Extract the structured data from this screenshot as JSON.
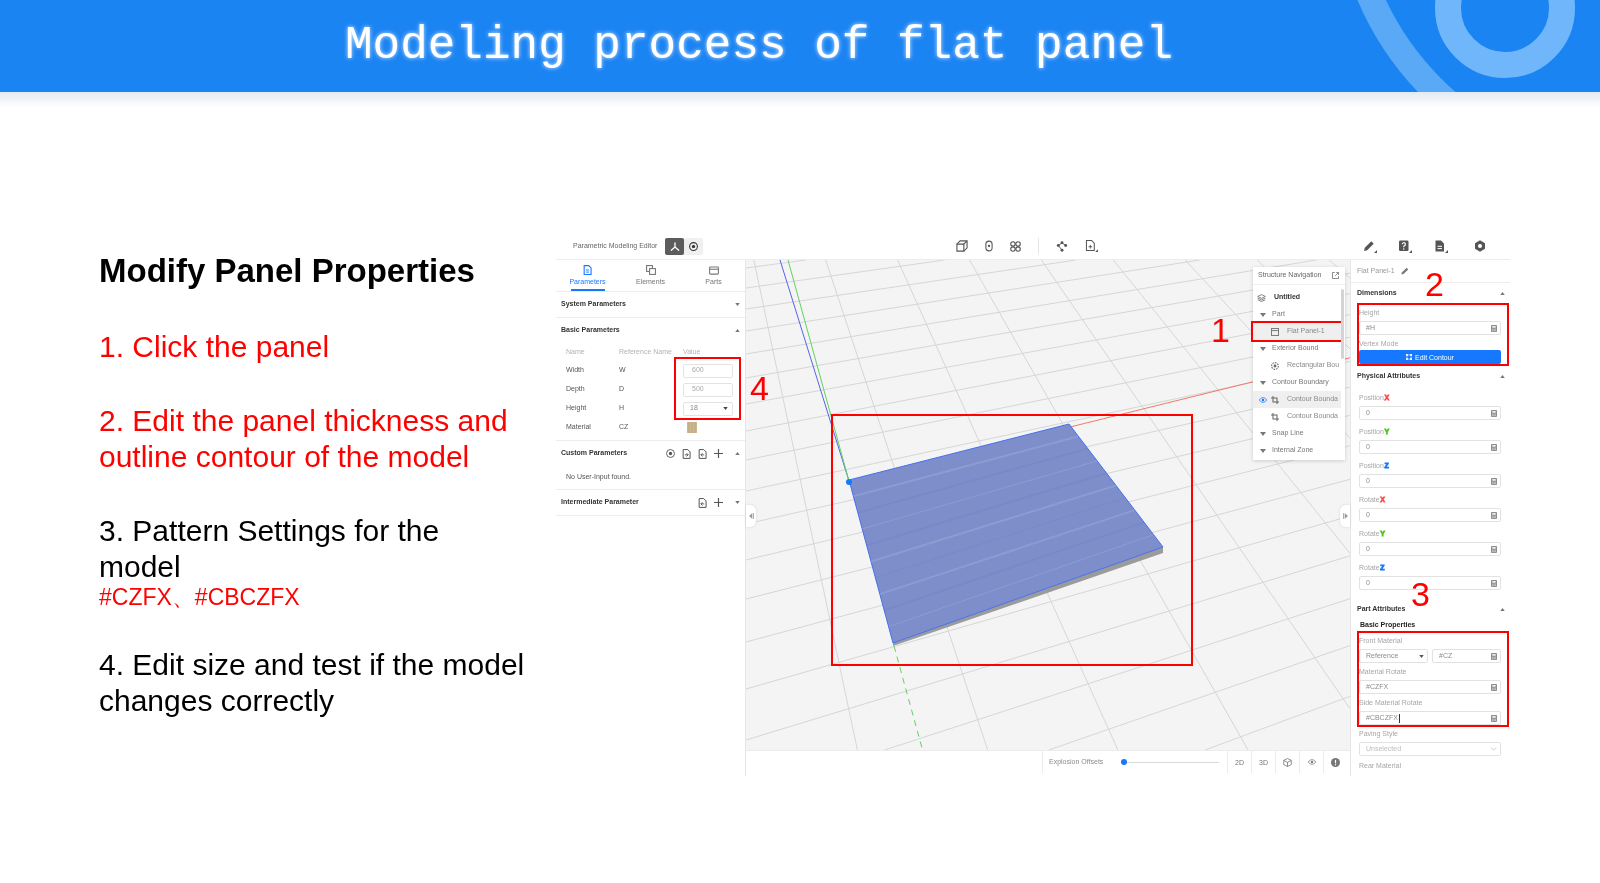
{
  "slide": {
    "title": "Modeling process of flat panel"
  },
  "instructions": {
    "heading": "Modify Panel Properties",
    "steps": [
      {
        "text": "1. Click the panel",
        "color": "#ff0000"
      },
      {
        "text": "2. Edit the panel thickness and outline contour of the model",
        "color": "#ff0000"
      },
      {
        "text": "3. Pattern Settings for the model",
        "color": "#000000",
        "note": "#CZFX、#CBCZFX"
      },
      {
        "text": "4. Edit size and test if the model changes correctly",
        "color": "#000000"
      }
    ]
  },
  "app": {
    "title": "Parametric Modeling Editor",
    "mode_buttons": [
      {
        "selected": true
      },
      {
        "selected": false
      }
    ],
    "left_panel": {
      "tabs": [
        {
          "label": "Parameters",
          "selected": true
        },
        {
          "label": "Elements",
          "selected": false
        },
        {
          "label": "Parts",
          "selected": false
        }
      ],
      "sections": [
        {
          "kind": "system",
          "title": "System Parameters",
          "expanded": false
        },
        {
          "kind": "basic",
          "title": "Basic Parameters",
          "expanded": true,
          "callout": "4",
          "columns": [
            "Name",
            "Reference Name",
            "Value"
          ],
          "rows": [
            {
              "name": "Width",
              "reference": "W",
              "kind": "input",
              "value": "600",
              "highlighted": true
            },
            {
              "name": "Depth",
              "reference": "D",
              "kind": "input",
              "value": "500",
              "highlighted": true
            },
            {
              "name": "Height",
              "reference": "H",
              "kind": "select",
              "value": "18",
              "highlighted": true
            },
            {
              "name": "Material",
              "reference": "CZ",
              "kind": "swatch",
              "highlighted": false
            }
          ]
        },
        {
          "kind": "custom",
          "title": "Custom Parameters",
          "expanded": true,
          "empty_text": "No User-Input found."
        },
        {
          "kind": "intermediate",
          "title": "Intermediate Parameter",
          "expanded": false
        }
      ]
    },
    "viewport": {
      "model": {
        "selected": true,
        "highlighted": true
      },
      "structure_navigation": {
        "title": "Structure Navigation",
        "root": "Untitled",
        "groups": [
          {
            "label": "Part",
            "expanded": true,
            "items": [
              {
                "label": "Flat Panel-1",
                "kind": "panel",
                "selected": true,
                "eye": false,
                "highlighted": true,
                "callout": "1"
              }
            ]
          },
          {
            "label": "Exterior Bound",
            "expanded": true,
            "items": [
              {
                "label": "Rectangular Bou",
                "kind": "boundary",
                "selected": false,
                "eye": false,
                "highlighted": false
              }
            ]
          },
          {
            "label": "Contour Boundary",
            "expanded": true,
            "items": [
              {
                "label": "Contour Bounda",
                "kind": "contour",
                "selected": true,
                "eye": true,
                "highlighted": false
              },
              {
                "label": "Contour Bounda",
                "kind": "contour",
                "selected": false,
                "eye": false,
                "highlighted": false
              }
            ]
          },
          {
            "label": "Snap Line",
            "expanded": true
          },
          {
            "label": "Internal Zone",
            "expanded": true
          }
        ]
      },
      "bottom_bar": {
        "label": "Explosion Offsets",
        "level": 0,
        "view_buttons": [
          "2D",
          "3D"
        ]
      }
    },
    "properties": {
      "title": "Flat Panel-1",
      "sections": [
        {
          "title": "Dimensions",
          "expanded": true,
          "callout": "2",
          "fields": [
            {
              "kind": "formula",
              "label": "Height",
              "value": "#H",
              "highlighted": true,
              "focused": false
            },
            {
              "kind": "button",
              "label": "Vertex Mode",
              "button": "Edit Contour",
              "highlighted": true,
              "focused": false
            }
          ]
        },
        {
          "title": "Physical Attributes",
          "expanded": true,
          "fields": [
            {
              "kind": "formula",
              "label": "Position",
              "axis": "X",
              "color": "#ff4d4f",
              "value": "0",
              "highlighted": false,
              "focused": false
            },
            {
              "kind": "formula",
              "label": "Position",
              "axis": "Y",
              "color": "#52c41a",
              "value": "0",
              "highlighted": false,
              "focused": false
            },
            {
              "kind": "formula",
              "label": "Position",
              "axis": "Z",
              "color": "#1677ff",
              "value": "0",
              "highlighted": false,
              "focused": false
            },
            {
              "kind": "formula",
              "label": "Rotate",
              "axis": "X",
              "color": "#ff4d4f",
              "value": "0",
              "highlighted": false,
              "focused": false
            },
            {
              "kind": "formula",
              "label": "Rotate",
              "axis": "Y",
              "color": "#52c41a",
              "value": "0",
              "highlighted": false,
              "focused": false
            },
            {
              "kind": "formula",
              "label": "Rotate",
              "axis": "Z",
              "color": "#1677ff",
              "value": "0",
              "highlighted": false,
              "focused": false
            }
          ]
        },
        {
          "title": "Part Attributes",
          "expanded": true,
          "callout": "3",
          "subtitle": "Basic Properties",
          "fields": [
            {
              "kind": "select_formula",
              "label": "Front Material",
              "option": "Reference",
              "value": "#CZ",
              "highlighted": true,
              "focused": false
            },
            {
              "kind": "formula",
              "label": "Material Rotate",
              "value": "#CZFX",
              "highlighted": true,
              "focused": false
            },
            {
              "kind": "formula",
              "label": "Side Material Rotate",
              "value": "#CBCZFX",
              "highlighted": true,
              "focused": true
            },
            {
              "kind": "select",
              "label": "Paving Style",
              "placeholder": "Unselected",
              "highlighted": false,
              "focused": false
            },
            {
              "kind": "label",
              "label": "Rear Material",
              "highlighted": false
            }
          ]
        }
      ]
    }
  }
}
